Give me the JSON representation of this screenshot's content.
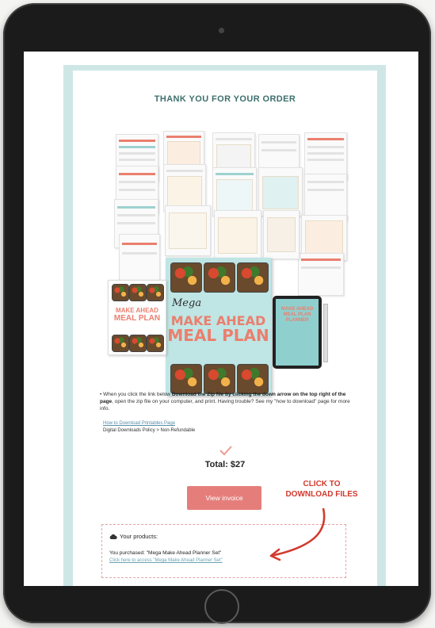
{
  "email": {
    "header_title": "THANK YOU FOR YOUR ORDER",
    "product_image": {
      "cover_script": "Mega",
      "cover_title_line1": "MAKE AHEAD",
      "cover_title_line2": "MEAL PLAN",
      "mini_cover_line1": "MAKE AHEAD",
      "mini_cover_line2": "MEAL PLAN",
      "ipad_title": "MAKE AHEAD MEAL PLAN PLANNER"
    },
    "instructions": {
      "part1": "When you click the link below ",
      "bold1": "Download the Zip file by clicking the down arrow on the top right of the page",
      "part2": ", open the zip file on your computer, and print. Having trouble? See my \"how to download\" page for more info."
    },
    "download_link": "How to Download Printables Page",
    "policy": "Digital Downloads Policy > Non-Refundable",
    "total": "Total: $27",
    "invoice_button": "View invoice",
    "products": {
      "heading": "Your products:",
      "purchased": "You purchased: \"Mega Make Ahead Planner Set\"",
      "access_link": "Click here to access \"Mega Make Ahead Planner Set\""
    }
  },
  "annotation": {
    "line1": "CLICK TO",
    "line2": "DOWNLOAD FILES"
  },
  "colors": {
    "accent_teal": "#cfe6e6",
    "button_coral": "#e57e7a",
    "annotation_red": "#d23a2e"
  }
}
